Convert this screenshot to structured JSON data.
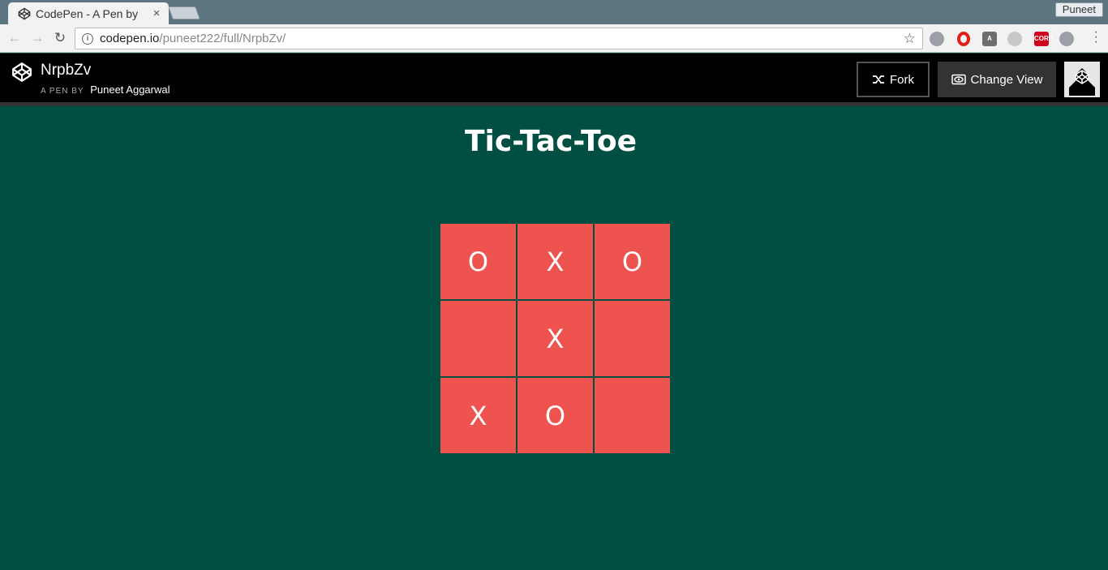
{
  "browser": {
    "tab_title": "CodePen - A Pen by",
    "tab_close": "×",
    "profile_name": "Puneet",
    "url_host": "codepen.io",
    "url_path": "/puneet222/full/NrpbZv/",
    "extensions": [
      {
        "name": "chromecast-icon",
        "label": "",
        "color": "#9aa0a6"
      },
      {
        "name": "opera-icon",
        "label": "",
        "color": "#e0201b"
      },
      {
        "name": "angular-icon",
        "label": "A",
        "color": "#6d6d6d"
      },
      {
        "name": "link-icon",
        "label": "",
        "color": "#c8c8c8"
      },
      {
        "name": "cors-icon",
        "label": "CORS",
        "color": "#d0021b"
      },
      {
        "name": "react-icon",
        "label": "",
        "color": "#9aa0a6"
      }
    ]
  },
  "codepen": {
    "pen_title": "NrpbZv",
    "byline_prefix": "A PEN BY",
    "author": "Puneet Aggarwal",
    "fork_label": "Fork",
    "change_view_label": "Change View"
  },
  "game": {
    "title": "Tic-Tac-Toe",
    "board": [
      "O",
      "X",
      "O",
      "",
      "X",
      "",
      "X",
      "O",
      ""
    ],
    "cell_color": "#ef5350",
    "background_color": "#004f42"
  }
}
